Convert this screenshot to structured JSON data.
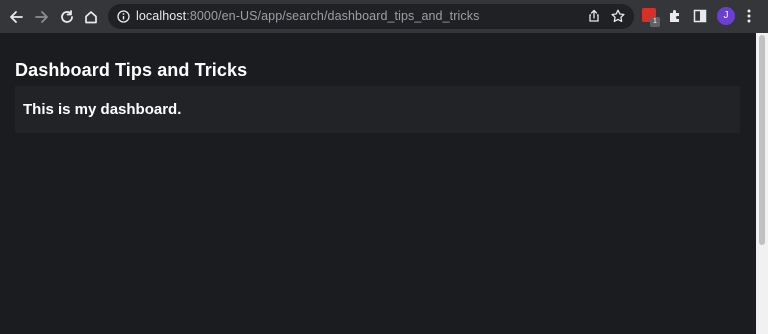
{
  "browser": {
    "url_host": "localhost",
    "url_path": ":8000/en-US/app/search/dashboard_tips_and_tricks",
    "extension_badge": "1",
    "profile_initial": "J",
    "icons": [
      "back-arrow-icon",
      "forward-arrow-icon",
      "reload-icon",
      "home-icon",
      "site-info-icon",
      "share-icon",
      "star-icon",
      "extension-icon",
      "puzzle-icon",
      "side-panel-icon",
      "kebab-menu-icon"
    ],
    "colors": {
      "toolbar": "#35363a",
      "omnibox": "#202124",
      "avatar": "#6a3fd1",
      "page_bg": "#1a1c1f"
    }
  },
  "dashboard": {
    "title": "Dashboard Tips and Tricks",
    "panel_text": "This is my dashboard."
  }
}
